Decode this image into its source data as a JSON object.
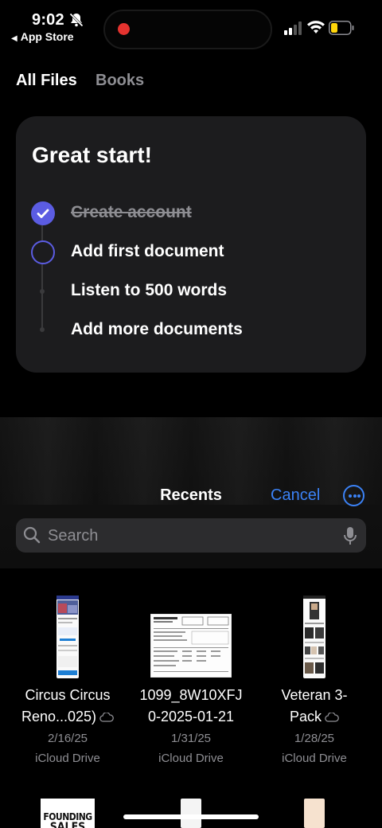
{
  "status_bar": {
    "time": "9:02",
    "back_app": "App Store",
    "icons": [
      "bell-slash-icon",
      "screen-recording-dot",
      "cellular-signal-icon",
      "wifi-icon",
      "battery-low-icon"
    ]
  },
  "tabs": [
    {
      "label": "All Files",
      "active": true
    },
    {
      "label": "Books",
      "active": false
    }
  ],
  "onboarding": {
    "title": "Great start!",
    "steps": [
      {
        "label": "Create account",
        "state": "done"
      },
      {
        "label": "Add first document",
        "state": "current"
      },
      {
        "label": "Listen to 500 words",
        "state": "todo"
      },
      {
        "label": "Add more documents",
        "state": "todo"
      }
    ],
    "accent_color": "#5b5ce2"
  },
  "picker": {
    "title": "Recents",
    "cancel_label": "Cancel",
    "more_icon": "ellipsis-circle-icon",
    "search": {
      "placeholder": "Search",
      "value": ""
    },
    "accent_color": "#3b82f6",
    "files": [
      {
        "name_line1": "Circus Circus",
        "name_line2": "Reno...025)",
        "cloud": true,
        "date": "2/16/25",
        "location": "iCloud Drive",
        "thumb": "phone-screenshot"
      },
      {
        "name_line1": "1099_8W10XFJ",
        "name_line2": "0-2025-01-21",
        "cloud": false,
        "date": "1/31/25",
        "location": "iCloud Drive",
        "thumb": "tax-form"
      },
      {
        "name_line1": "Veteran 3-",
        "name_line2": "Pack",
        "cloud": true,
        "date": "1/28/25",
        "location": "iCloud Drive",
        "thumb": "phone-screenshot-products"
      }
    ],
    "partial_row": {
      "thumb1_text_line1": "FOUNDING",
      "thumb1_text_line2": "SALES"
    }
  }
}
